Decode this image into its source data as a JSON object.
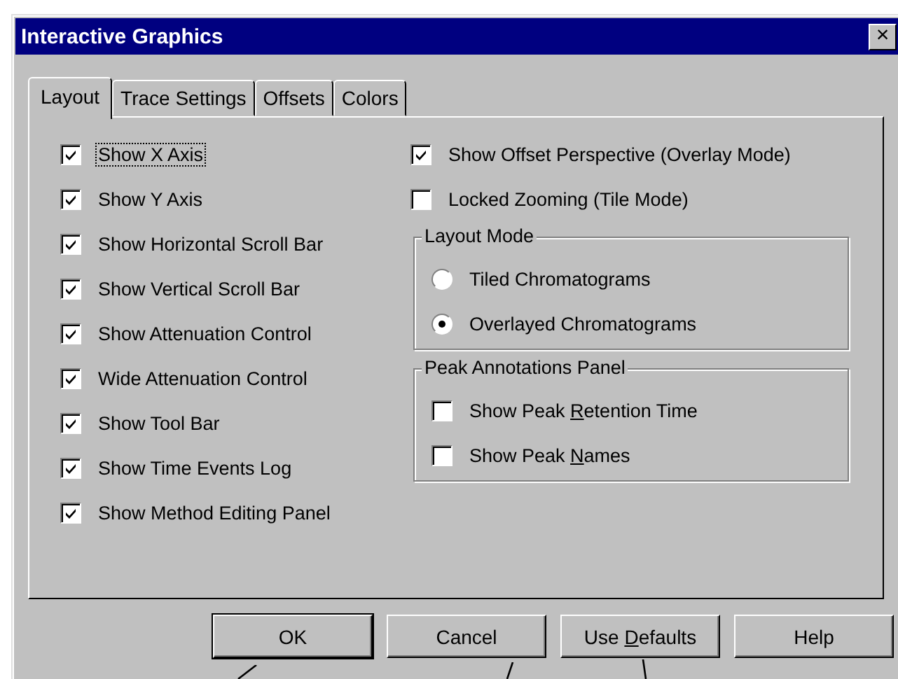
{
  "window": {
    "title": "Interactive Graphics",
    "close": "×"
  },
  "tabs": [
    {
      "label": "Layout",
      "selected": true
    },
    {
      "label": "Trace Settings",
      "selected": false
    },
    {
      "label": "Offsets",
      "selected": false
    },
    {
      "label": "Colors",
      "selected": false
    }
  ],
  "left_options": [
    {
      "label": "Show X Axis",
      "checked": true,
      "focused": true
    },
    {
      "label": "Show Y Axis",
      "checked": true,
      "focused": false
    },
    {
      "label": "Show Horizontal Scroll Bar",
      "checked": true,
      "focused": false
    },
    {
      "label": "Show Vertical Scroll Bar",
      "checked": true,
      "focused": false
    },
    {
      "label": "Show Attenuation Control",
      "checked": true,
      "focused": false
    },
    {
      "label": "Wide Attenuation Control",
      "checked": true,
      "focused": false
    },
    {
      "label": "Show Tool Bar",
      "checked": true,
      "focused": false
    },
    {
      "label": "Show Time Events Log",
      "checked": true,
      "focused": false
    },
    {
      "label": "Show Method Editing Panel",
      "checked": true,
      "focused": false
    }
  ],
  "right_options": [
    {
      "label": "Show Offset Perspective (Overlay Mode)",
      "checked": true
    },
    {
      "label": "Locked Zooming (Tile Mode)",
      "checked": false
    }
  ],
  "layout_mode": {
    "title": "Layout Mode",
    "options": [
      {
        "label": "Tiled Chromatograms",
        "selected": false
      },
      {
        "label": "Overlayed Chromatograms",
        "selected": true
      }
    ]
  },
  "peak_annotations": {
    "title": "Peak Annotations Panel",
    "options": [
      {
        "label": {
          "before": "Show Peak ",
          "key": "R",
          "after": "etention Time"
        },
        "checked": false
      },
      {
        "label": {
          "before": "Show Peak ",
          "key": "N",
          "after": "ames"
        },
        "checked": false
      }
    ]
  },
  "buttons": [
    {
      "label": {
        "before": "OK"
      },
      "kind": "default"
    },
    {
      "label": {
        "before": "Cancel"
      },
      "kind": "normal"
    },
    {
      "label": {
        "before": "Use ",
        "key": "D",
        "after": "efaults"
      },
      "kind": "normal"
    },
    {
      "label": {
        "before": "Help"
      },
      "kind": "normal"
    }
  ]
}
